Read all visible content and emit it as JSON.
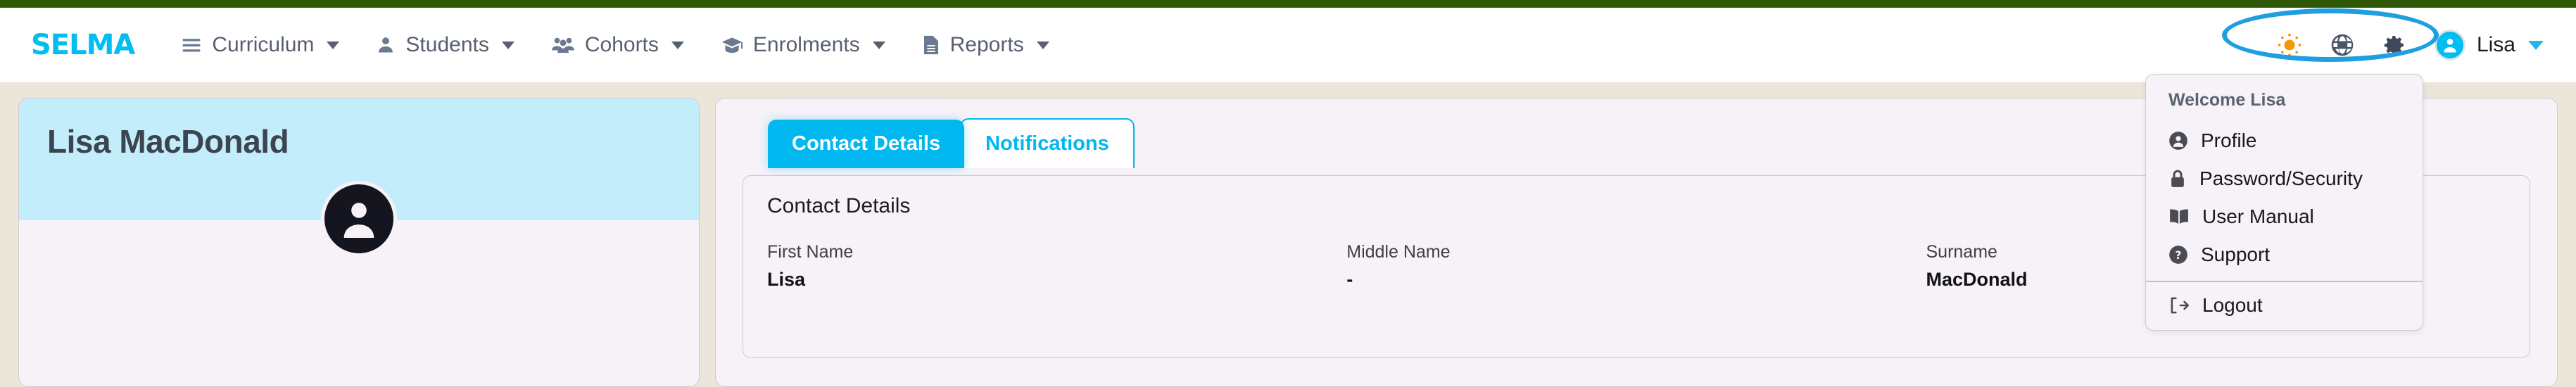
{
  "brand": {
    "name": "SELMA",
    "color": "#00BDF2"
  },
  "theme": {
    "green_bar": "#2F5906",
    "page_background": "#ECE5DA",
    "card_background": "#F7F2F8",
    "banner_blue": "#C3EDFB",
    "accent_cyan": "#00B7F0",
    "highlight_ring": "#1F9FE0",
    "sun_orange": "#FA9600",
    "icon_slate": "#4A5568"
  },
  "nav": {
    "items": [
      {
        "label": "Curriculum",
        "icon": "hamburger-menu-icon",
        "has_caret": true
      },
      {
        "label": "Students",
        "icon": "person-icon",
        "has_caret": true
      },
      {
        "label": "Cohorts",
        "icon": "people-group-icon",
        "has_caret": true
      },
      {
        "label": "Enrolments",
        "icon": "graduation-cap-icon",
        "has_caret": true
      },
      {
        "label": "Reports",
        "icon": "document-icon",
        "has_caret": true
      }
    ],
    "right_icons": [
      {
        "name": "sun-icon",
        "title": "Theme"
      },
      {
        "name": "globe-icon",
        "title": "Language"
      },
      {
        "name": "gear-icon",
        "title": "Settings"
      }
    ],
    "user": {
      "name": "Lisa",
      "avatar_icon": "user-avatar-icon"
    }
  },
  "user_dropdown": {
    "header": "Welcome Lisa",
    "items": [
      {
        "label": "Profile",
        "icon": "person-circle-icon"
      },
      {
        "label": "Password/Security",
        "icon": "lock-icon"
      },
      {
        "label": "User Manual",
        "icon": "book-icon"
      },
      {
        "label": "Support",
        "icon": "question-circle-icon"
      }
    ],
    "logout": {
      "label": "Logout",
      "icon": "logout-arrow-icon"
    }
  },
  "profile_card": {
    "full_name": "Lisa MacDonald",
    "avatar_icon": "user-avatar-large-icon"
  },
  "main": {
    "tabs": [
      {
        "label": "Contact Details",
        "active": true
      },
      {
        "label": "Notifications",
        "active": false
      }
    ],
    "panel": {
      "title": "Contact Details",
      "fields": [
        {
          "label": "First Name",
          "value": "Lisa"
        },
        {
          "label": "Middle Name",
          "value": "-"
        },
        {
          "label": "Surname",
          "value": "MacDonald"
        }
      ]
    }
  }
}
